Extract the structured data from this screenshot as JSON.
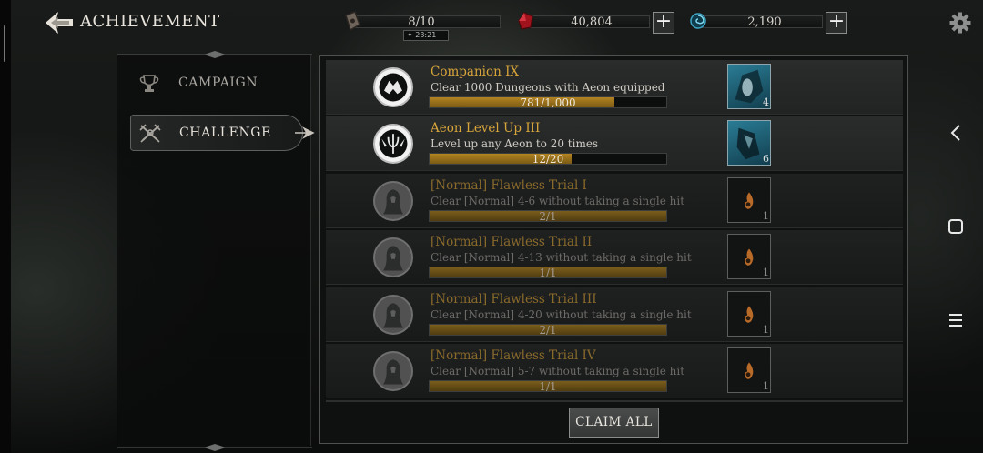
{
  "header": {
    "title": "ACHIEVEMENT",
    "stamina": {
      "value": "8/10",
      "timer": "23:21"
    },
    "gems": {
      "value": "40,804"
    },
    "orbs": {
      "value": "2,190"
    }
  },
  "sidebar": {
    "items": [
      {
        "label": "CAMPAIGN",
        "active": false
      },
      {
        "label": "CHALLENGE",
        "active": true
      }
    ]
  },
  "achievements": [
    {
      "title": "Companion IX",
      "description": "Clear 1000 Dungeons with Aeon equipped",
      "progress_text": "781/1,000",
      "progress": 0.781,
      "reward_qty": "4",
      "state": "done"
    },
    {
      "title": "Aeon Level Up III",
      "description": "Level up any Aeon to 20 times",
      "progress_text": "12/20",
      "progress": 0.6,
      "reward_qty": "6",
      "state": "done"
    },
    {
      "title": "[Normal] Flawless Trial I",
      "description": "Clear [Normal] 4-6 without taking a single hit",
      "progress_text": "2/1",
      "progress": 1.0,
      "reward_qty": "1",
      "state": "locked"
    },
    {
      "title": "[Normal] Flawless Trial II",
      "description": "Clear [Normal] 4-13 without taking a single hit",
      "progress_text": "1/1",
      "progress": 1.0,
      "reward_qty": "1",
      "state": "locked"
    },
    {
      "title": "[Normal] Flawless Trial III",
      "description": "Clear [Normal] 4-20 without taking a single hit",
      "progress_text": "2/1",
      "progress": 1.0,
      "reward_qty": "1",
      "state": "locked"
    },
    {
      "title": "[Normal] Flawless Trial IV",
      "description": "Clear [Normal] 5-7 without taking a single hit",
      "progress_text": "1/1",
      "progress": 1.0,
      "reward_qty": "1",
      "state": "locked"
    }
  ],
  "footer": {
    "claim_all_label": "CLAIM ALL"
  },
  "colors": {
    "accent_gold": "#d8a53a",
    "progress_gold": "#b38421",
    "reward_blue": "#2a7c95"
  }
}
